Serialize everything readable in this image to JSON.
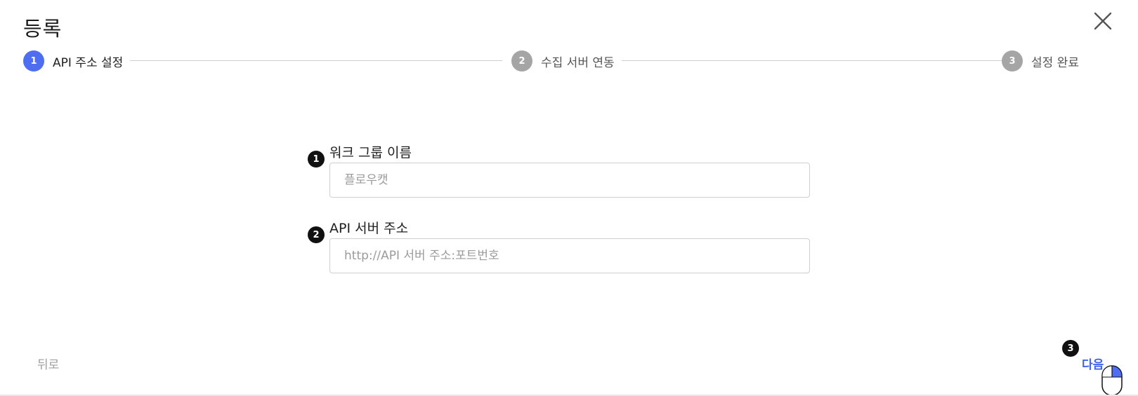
{
  "dialog": {
    "title": "등록"
  },
  "stepper": {
    "steps": [
      {
        "num": "1",
        "label": "API 주소 설정",
        "state": "active"
      },
      {
        "num": "2",
        "label": "수집 서버 연동",
        "state": "inactive"
      },
      {
        "num": "3",
        "label": "설정 완료",
        "state": "inactive"
      }
    ],
    "active_color": "#4f6df0",
    "inactive_color": "#a5a5a5"
  },
  "form": {
    "fields": [
      {
        "marker": "1",
        "label": "워크 그룹 이름",
        "value": "",
        "placeholder": "플로우캣"
      },
      {
        "marker": "2",
        "label": "API 서버 주소",
        "value": "",
        "placeholder": "http://API 서버 주소:포트번호"
      }
    ]
  },
  "footer": {
    "back_label": "뒤로",
    "next_label": "다음",
    "next_marker": "3",
    "next_color": "#3d63f0"
  },
  "icons": {
    "close": "close-icon",
    "cursor": "mouse-icon"
  }
}
